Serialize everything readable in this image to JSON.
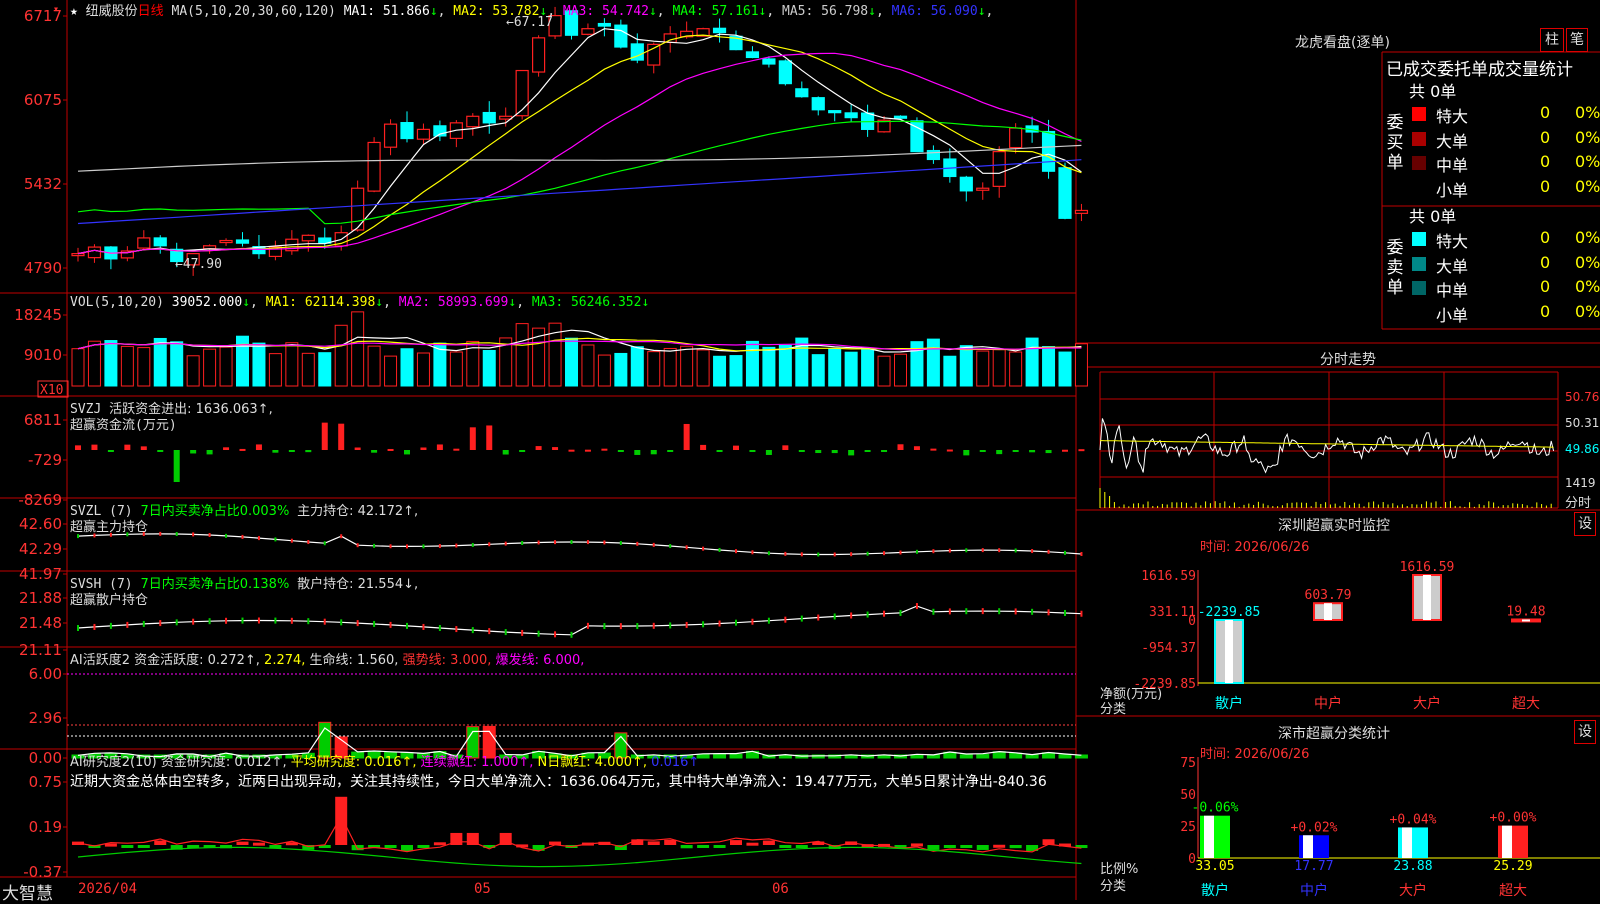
{
  "app": {
    "brand": "大智慧"
  },
  "kline": {
    "star": "★",
    "name": "纽威股份",
    "period": "日线",
    "ma_params": "MA(5,10,20,30,60,120)",
    "ma_values": [
      {
        "label": "MA1:",
        "value": "51.866",
        "arrow": "↓",
        "color": "#ffffff"
      },
      {
        "label": "MA2:",
        "value": "53.782",
        "arrow": "↓",
        "color": "#ffff00"
      },
      {
        "label": "MA3:",
        "value": "54.742",
        "arrow": "↓",
        "color": "#ff00ff"
      },
      {
        "label": "MA4:",
        "value": "57.161",
        "arrow": "↓",
        "color": "#00ff00"
      },
      {
        "label": "MA5:",
        "value": "56.798",
        "arrow": "↓",
        "color": "#cccccc"
      },
      {
        "label": "MA6:",
        "value": "56.090",
        "arrow": "↓",
        "color": "#3333ff"
      }
    ],
    "y_ticks": [
      "6717",
      "6075",
      "5432",
      "4790"
    ],
    "high_label": "67.17",
    "low_label": "47.90"
  },
  "vol": {
    "title": "VOL(5,10,20)",
    "value": "39052.000",
    "ma1": "62114.398",
    "ma2": "58993.699",
    "ma3": "56246.352",
    "arrow": "↓",
    "y_ticks": [
      "18245",
      "9010"
    ],
    "unit": "X10"
  },
  "svzj": {
    "title": "SVZJ",
    "desc": "活跃资金进出: 1636.063↑,",
    "sub": "超赢资金流(万元)",
    "y_ticks": [
      "6811",
      "-729",
      "-8269"
    ]
  },
  "svzl": {
    "title": "SVZL (7)",
    "ratio": "7日内买卖净占比0.003%",
    "hold": "主力持仓: 42.172↑,",
    "sub": "超赢主力持仓",
    "y_ticks": [
      "42.60",
      "42.29",
      "41.97"
    ]
  },
  "svsh": {
    "title": "SVSH (7)",
    "ratio": "7日内买卖净占比0.138%",
    "hold": "散户持仓: 21.554↓,",
    "sub": "超赢散户持仓",
    "y_ticks": [
      "21.88",
      "21.48",
      "21.11"
    ]
  },
  "ai_active": {
    "title": "AI活跃度2",
    "deg": "资金活跃度: 0.272↑,",
    "v2": "2.274,",
    "life": "生命线: 1.560,",
    "strong": "强势线: 3.000,",
    "boom": "爆发线: 6.000,",
    "y_ticks": [
      "6.00",
      "2.96",
      "0.00"
    ]
  },
  "ai_research": {
    "title": "AI研究度2(10)",
    "deg": "资金研究度: 0.012↑,",
    "avg": "平均研究度: 0.016↑,",
    "cont": "连续飘红: 1.000↑,",
    "nday": "N日飘红: 4.000↑,",
    "last": "0.016↑",
    "note": "近期大资金总体由空转多，近两日出现异动，关注其持续性，今日大单净流入：1636.064万元，其中特大单净流入：19.477万元，大单5日累计净出-840.36",
    "y_ticks": [
      "0.75",
      "0.19",
      "-0.37"
    ]
  },
  "x_axis": {
    "d1": "2026/04",
    "d2": "05",
    "d3": "06"
  },
  "longhu": {
    "title": "龙虎看盘(逐单)",
    "btn1": "柱",
    "btn2": "笔",
    "header": "已成交委托单成交量统计",
    "buy_label": "委买单",
    "sell_label": "委卖单",
    "buy_total": "共 0单",
    "sell_total": "共 0单",
    "buy_rows": [
      {
        "name": "特大",
        "count": "0",
        "pct": "0%",
        "color": "#ff0000"
      },
      {
        "name": "大单",
        "count": "0",
        "pct": "0%",
        "color": "#aa0000"
      },
      {
        "name": "中单",
        "count": "0",
        "pct": "0%",
        "color": "#660000"
      },
      {
        "name": "小单",
        "count": "0",
        "pct": "0%",
        "color": "#000000"
      }
    ],
    "sell_rows": [
      {
        "name": "特大",
        "count": "0",
        "pct": "0%",
        "color": "#00ffff"
      },
      {
        "name": "大单",
        "count": "0",
        "pct": "0%",
        "color": "#008888"
      },
      {
        "name": "中单",
        "count": "0",
        "pct": "0%",
        "color": "#006666"
      },
      {
        "name": "小单",
        "count": "0",
        "pct": "0%",
        "color": "#000000"
      }
    ]
  },
  "intraday": {
    "title": "分时走势",
    "y_ticks": [
      "50.76",
      "50.31",
      "49.86"
    ],
    "vol_tick": "1419",
    "unit": "分时"
  },
  "monitor": {
    "title": "深圳超赢实时监控",
    "btn": "设",
    "time": "时间: 2026/06/26",
    "y_ticks": [
      "1616.59",
      "331.11",
      "0",
      "-954.37",
      "-2239.85"
    ],
    "ylabel": "净额(万元)",
    "xlabel": "分类"
  },
  "classify": {
    "title": "深市超赢分类统计",
    "btn": "设",
    "time": "时间: 2026/06/26",
    "y_ticks": [
      "75",
      "50",
      "25",
      "0"
    ],
    "ylabel": "比例%",
    "xlabel": "分类"
  },
  "chart_data": [
    {
      "type": "bar",
      "title": "深圳超赢实时监控",
      "ylabel": "净额(万元)",
      "xlabel": "分类",
      "categories": [
        "散户",
        "中户",
        "大户",
        "超大"
      ],
      "values": [
        -2239.85,
        603.79,
        1616.59,
        19.48
      ],
      "value_labels": [
        "-2239.85",
        "603.79",
        "1616.59",
        "19.48"
      ],
      "ylim": [
        -2239.85,
        1616.59
      ]
    },
    {
      "type": "bar",
      "title": "深市超赢分类统计",
      "ylabel": "比例%",
      "xlabel": "分类",
      "categories": [
        "散户",
        "中户",
        "大户",
        "超大"
      ],
      "values": [
        33.05,
        17.77,
        23.88,
        25.29
      ],
      "change_labels": [
        "-0.06%",
        "+0.02%",
        "+0.04%",
        "+0.00%"
      ],
      "ylim": [
        0,
        75
      ]
    }
  ]
}
